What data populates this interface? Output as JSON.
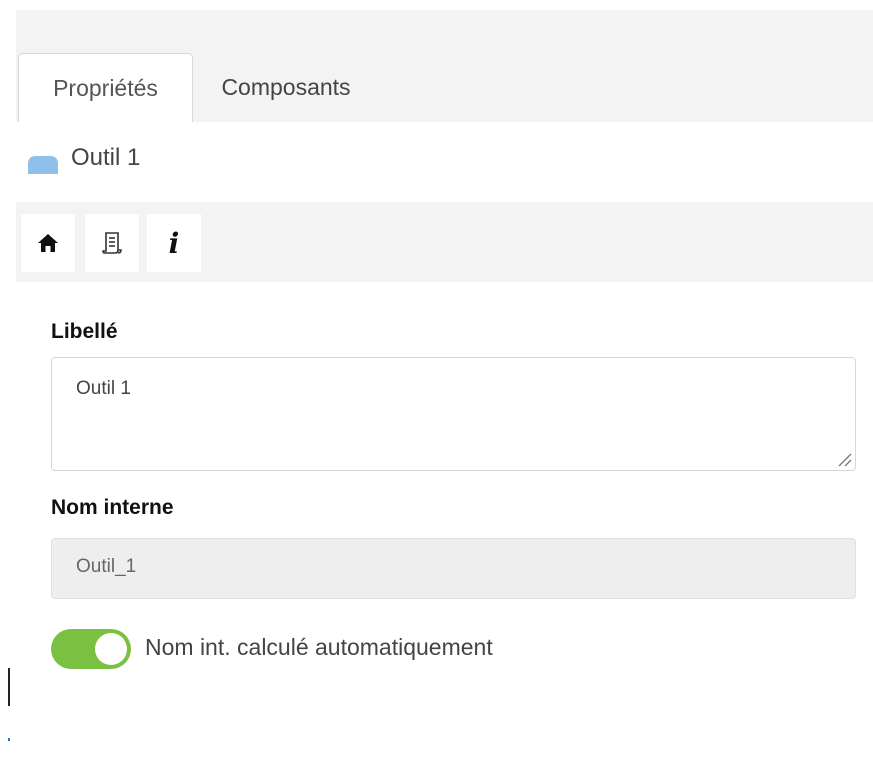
{
  "tabs": [
    {
      "label": "Propriétés",
      "active": true
    },
    {
      "label": "Composants",
      "active": false
    }
  ],
  "object": {
    "title": "Outil 1",
    "icon": "tool-object-icon",
    "icon_color": "#8ec0ea"
  },
  "toolbar": {
    "buttons": [
      {
        "icon": "home-icon"
      },
      {
        "icon": "document-icon"
      },
      {
        "icon": "info-icon",
        "glyph": "i"
      }
    ]
  },
  "form": {
    "label_field": {
      "label": "Libellé",
      "value": "Outil 1"
    },
    "internal_name": {
      "label": "Nom interne",
      "value": "Outil_1"
    },
    "auto_toggle": {
      "label": "Nom int. calculé automatiquement",
      "on": true,
      "color": "#7ac142"
    }
  }
}
